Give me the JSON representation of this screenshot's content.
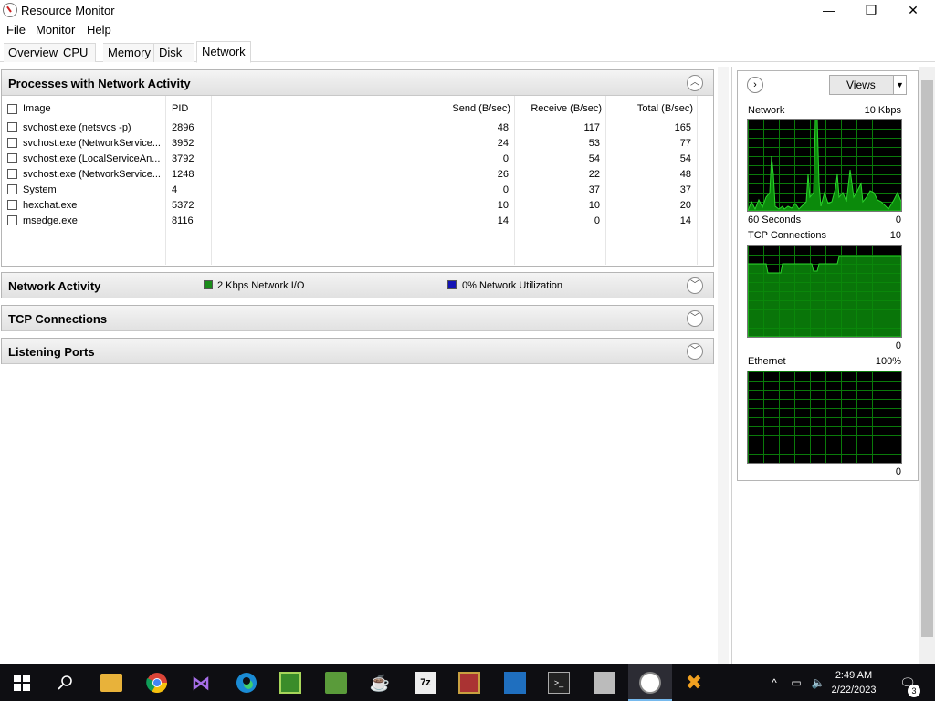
{
  "window": {
    "title": "Resource Monitor",
    "minimize": "—",
    "maximize": "❐",
    "close": "✕"
  },
  "menu": {
    "file": "File",
    "monitor": "Monitor",
    "help": "Help"
  },
  "tabs": [
    "Overview",
    "CPU",
    "Memory",
    "Disk",
    "Network"
  ],
  "processes": {
    "title": "Processes with Network Activity",
    "headers": {
      "image": "Image",
      "pid": "PID",
      "send": "Send (B/sec)",
      "receive": "Receive (B/sec)",
      "total": "Total (B/sec)"
    },
    "rows": [
      {
        "image": "svchost.exe (netsvcs -p)",
        "pid": "2896",
        "send": "48",
        "receive": "117",
        "total": "165"
      },
      {
        "image": "svchost.exe (NetworkService...",
        "pid": "3952",
        "send": "24",
        "receive": "53",
        "total": "77"
      },
      {
        "image": "svchost.exe (LocalServiceAn...",
        "pid": "3792",
        "send": "0",
        "receive": "54",
        "total": "54"
      },
      {
        "image": "svchost.exe (NetworkService...",
        "pid": "1248",
        "send": "26",
        "receive": "22",
        "total": "48"
      },
      {
        "image": "System",
        "pid": "4",
        "send": "0",
        "receive": "37",
        "total": "37"
      },
      {
        "image": "hexchat.exe",
        "pid": "5372",
        "send": "10",
        "receive": "10",
        "total": "20"
      },
      {
        "image": "msedge.exe",
        "pid": "8116",
        "send": "14",
        "receive": "0",
        "total": "14"
      }
    ]
  },
  "network_activity": {
    "title": "Network Activity",
    "io": "2 Kbps Network I/O",
    "util": "0% Network Utilization",
    "io_color": "#1a8c1a",
    "util_color": "#1414b4"
  },
  "tcp": {
    "title": "TCP Connections"
  },
  "listening": {
    "title": "Listening Ports"
  },
  "right": {
    "views": "Views",
    "network": {
      "label": "Network",
      "max": "10 Kbps",
      "time": "60 Seconds",
      "min": "0"
    },
    "tcp": {
      "label": "TCP Connections",
      "max": "10",
      "min": "0"
    },
    "ethernet": {
      "label": "Ethernet",
      "max": "100%",
      "min": "0"
    }
  },
  "taskbar": {
    "time": "2:49 AM",
    "date": "2/22/2023",
    "notifications": "3"
  }
}
